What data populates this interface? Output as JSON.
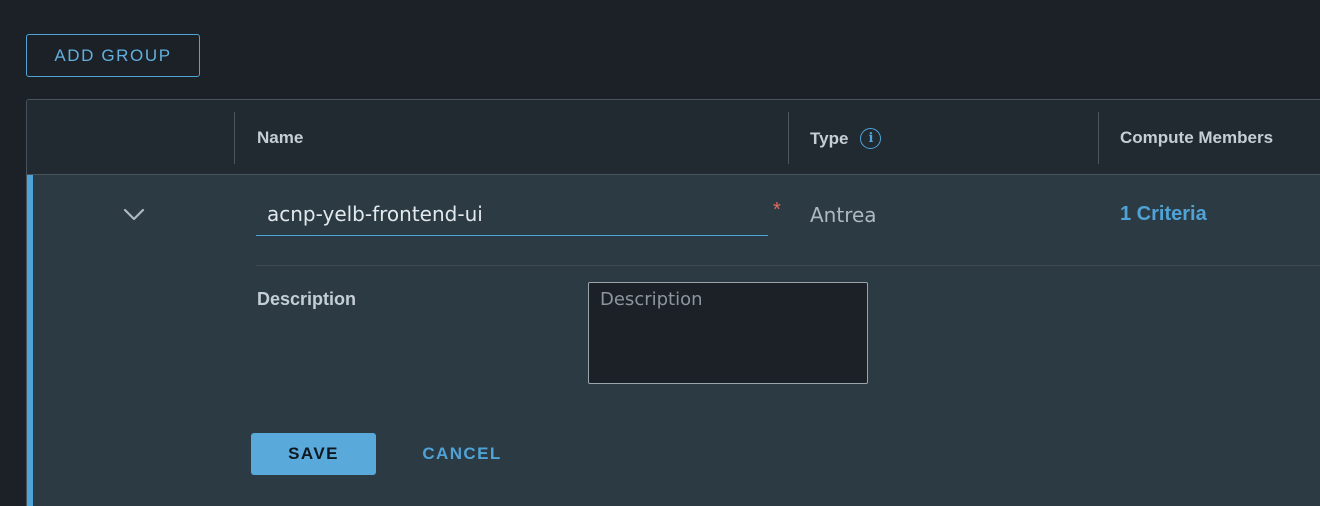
{
  "toolbar": {
    "add_group_label": "ADD GROUP"
  },
  "table": {
    "columns": {
      "name": "Name",
      "type": "Type",
      "compute_members": "Compute Members"
    },
    "row": {
      "name_value": "acnp-yelb-frontend-ui",
      "required_marker": "*",
      "type_value": "Antrea",
      "compute_members_value": "1 Criteria",
      "description_label": "Description",
      "description_placeholder": "Description",
      "save_label": "SAVE",
      "cancel_label": "CANCEL"
    }
  },
  "icons": {
    "expand": "chevron-down-icon",
    "type_info": "info-icon"
  },
  "colors": {
    "accent": "#4fa3d6",
    "background": "#1b2127",
    "row_background": "#2c3a43",
    "required": "#e66a5c"
  }
}
